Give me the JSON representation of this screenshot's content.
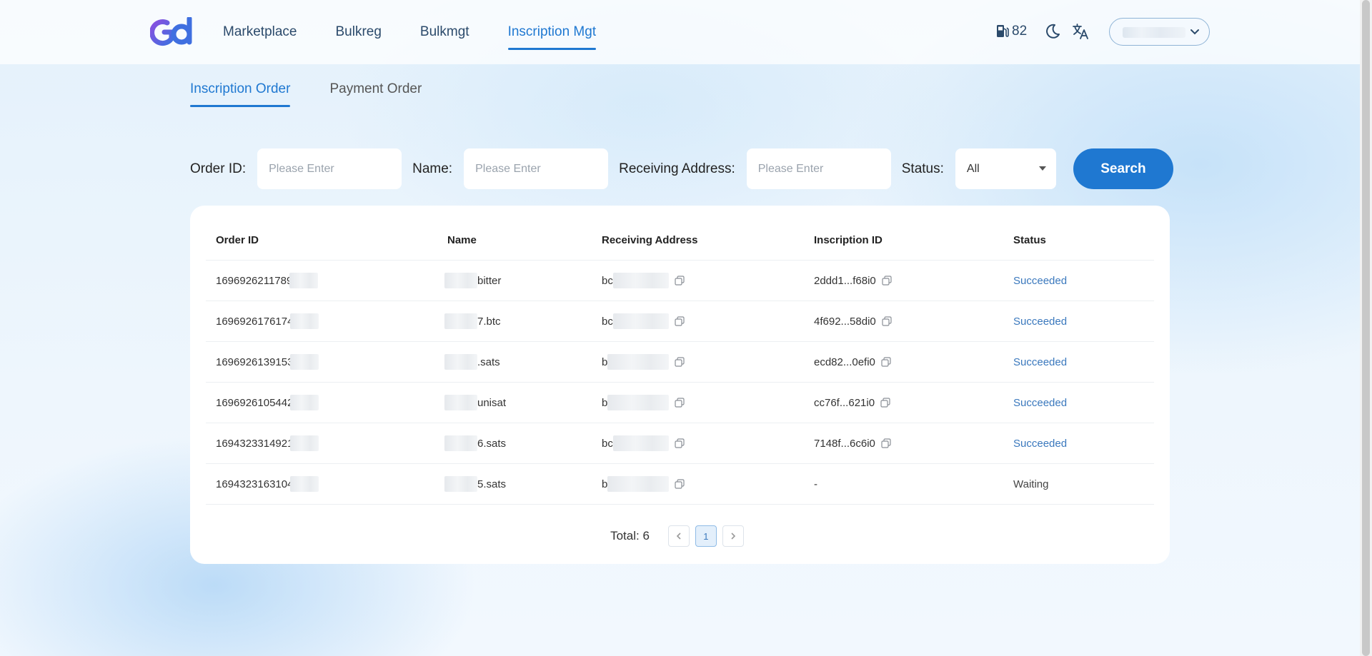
{
  "nav": {
    "items": [
      {
        "label": "Marketplace",
        "active": false
      },
      {
        "label": "Bulkreg",
        "active": false
      },
      {
        "label": "Bulkmgt",
        "active": false
      },
      {
        "label": "Inscription Mgt",
        "active": true
      }
    ],
    "gas_value": "82"
  },
  "tabs": [
    {
      "label": "Inscription Order",
      "active": true
    },
    {
      "label": "Payment Order",
      "active": false
    }
  ],
  "filters": {
    "order_id_label": "Order ID:",
    "order_id_placeholder": "Please Enter",
    "name_label": "Name:",
    "name_placeholder": "Please Enter",
    "address_label": "Receiving Address:",
    "address_placeholder": "Please Enter",
    "status_label": "Status:",
    "status_value": "All",
    "search_label": "Search"
  },
  "table": {
    "headers": [
      "Order ID",
      "Name",
      "Receiving Address",
      "Inscription ID",
      "Status"
    ],
    "rows": [
      {
        "order_id": "1696926211789",
        "name": "bitter",
        "address": "bc",
        "inscription_id": "2ddd1...f68i0",
        "status": "Succeeded"
      },
      {
        "order_id": "1696926176174",
        "name": "7.btc",
        "address": "bc",
        "inscription_id": "4f692...58di0",
        "status": "Succeeded"
      },
      {
        "order_id": "1696926139153",
        "name": ".sats",
        "address": "b",
        "inscription_id": "ecd82...0efi0",
        "status": "Succeeded"
      },
      {
        "order_id": "1696926105442",
        "name": "unisat",
        "address": "b",
        "inscription_id": "cc76f...621i0",
        "status": "Succeeded"
      },
      {
        "order_id": "1694323314921",
        "name": "6.sats",
        "address": "bc",
        "inscription_id": "7148f...6c6i0",
        "status": "Succeeded"
      },
      {
        "order_id": "1694323163104",
        "name": "5.sats",
        "address": "b",
        "inscription_id": "-",
        "status": "Waiting"
      }
    ]
  },
  "pagination": {
    "total_label": "Total: 6",
    "current_page": "1"
  },
  "colors": {
    "accent": "#1f78d1",
    "success": "#3a78bd",
    "background": "#eaf4fc"
  },
  "icons": [
    "logo-icon",
    "gas-pump-icon",
    "moon-icon",
    "translate-icon",
    "chevron-down-icon",
    "copy-icon",
    "chevron-left-icon",
    "chevron-right-icon"
  ]
}
